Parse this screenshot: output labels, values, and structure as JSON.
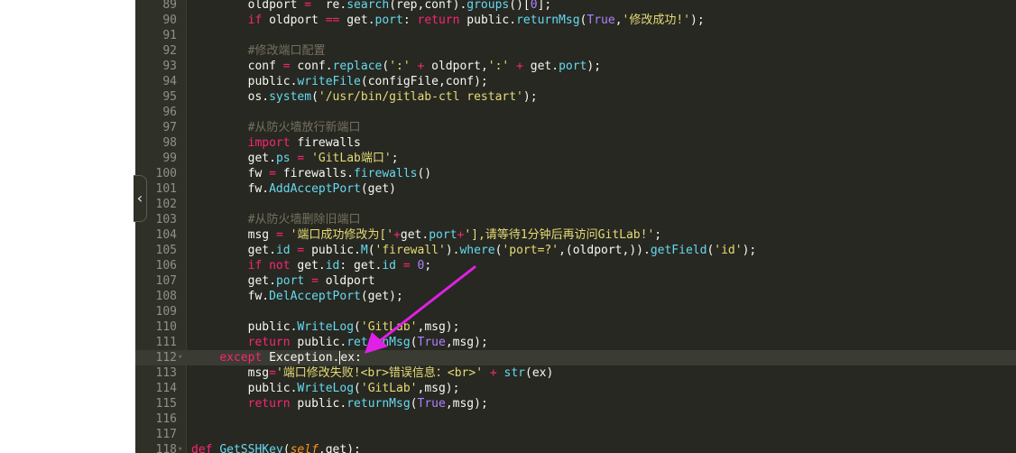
{
  "editor": {
    "lines": [
      {
        "num": "89",
        "tokens": [
          {
            "t": "oldport",
            "c": ""
          },
          {
            "t": " = ",
            "c": "o"
          },
          {
            "t": " re.",
            "c": ""
          },
          {
            "t": "search",
            "c": "f"
          },
          {
            "t": "(rep,conf).",
            "c": ""
          },
          {
            "t": "groups",
            "c": "f"
          },
          {
            "t": "()[",
            "c": ""
          },
          {
            "t": "0",
            "c": "n"
          },
          {
            "t": "];",
            "c": ""
          }
        ],
        "indent": "        "
      },
      {
        "num": "90",
        "tokens": [
          {
            "t": "if",
            "c": "k"
          },
          {
            "t": " oldport ",
            "c": ""
          },
          {
            "t": "==",
            "c": "o"
          },
          {
            "t": " get.",
            "c": ""
          },
          {
            "t": "port",
            "c": "f"
          },
          {
            "t": ": ",
            "c": ""
          },
          {
            "t": "return",
            "c": "k"
          },
          {
            "t": " public.",
            "c": ""
          },
          {
            "t": "returnMsg",
            "c": "f"
          },
          {
            "t": "(",
            "c": ""
          },
          {
            "t": "True",
            "c": "n"
          },
          {
            "t": ",",
            "c": ""
          },
          {
            "t": "'修改成功!'",
            "c": "s"
          },
          {
            "t": ");",
            "c": ""
          }
        ],
        "indent": "        "
      },
      {
        "num": "91",
        "tokens": [],
        "indent": ""
      },
      {
        "num": "92",
        "tokens": [
          {
            "t": "#修改端口配置",
            "c": "c"
          }
        ],
        "indent": "        "
      },
      {
        "num": "93",
        "tokens": [
          {
            "t": "conf ",
            "c": ""
          },
          {
            "t": "=",
            "c": "o"
          },
          {
            "t": " conf.",
            "c": ""
          },
          {
            "t": "replace",
            "c": "f"
          },
          {
            "t": "(",
            "c": ""
          },
          {
            "t": "':'",
            "c": "s"
          },
          {
            "t": " + ",
            "c": "o"
          },
          {
            "t": "oldport,",
            "c": ""
          },
          {
            "t": "':'",
            "c": "s"
          },
          {
            "t": " + ",
            "c": "o"
          },
          {
            "t": "get.",
            "c": ""
          },
          {
            "t": "port",
            "c": "f"
          },
          {
            "t": ");",
            "c": ""
          }
        ],
        "indent": "        "
      },
      {
        "num": "94",
        "tokens": [
          {
            "t": "public.",
            "c": ""
          },
          {
            "t": "writeFile",
            "c": "f"
          },
          {
            "t": "(configFile,conf);",
            "c": ""
          }
        ],
        "indent": "        "
      },
      {
        "num": "95",
        "tokens": [
          {
            "t": "os.",
            "c": ""
          },
          {
            "t": "system",
            "c": "f"
          },
          {
            "t": "(",
            "c": ""
          },
          {
            "t": "'/usr/bin/gitlab-ctl restart'",
            "c": "s"
          },
          {
            "t": ");",
            "c": ""
          }
        ],
        "indent": "        "
      },
      {
        "num": "96",
        "tokens": [],
        "indent": ""
      },
      {
        "num": "97",
        "tokens": [
          {
            "t": "#从防火墙放行新端口",
            "c": "c"
          }
        ],
        "indent": "        "
      },
      {
        "num": "98",
        "tokens": [
          {
            "t": "import",
            "c": "k"
          },
          {
            "t": " firewalls",
            "c": ""
          }
        ],
        "indent": "        "
      },
      {
        "num": "99",
        "tokens": [
          {
            "t": "get.",
            "c": ""
          },
          {
            "t": "ps",
            "c": "f"
          },
          {
            "t": " = ",
            "c": "o"
          },
          {
            "t": "'GitLab端口'",
            "c": "s"
          },
          {
            "t": ";",
            "c": ""
          }
        ],
        "indent": "        "
      },
      {
        "num": "100",
        "tokens": [
          {
            "t": "fw ",
            "c": ""
          },
          {
            "t": "=",
            "c": "o"
          },
          {
            "t": " firewalls.",
            "c": ""
          },
          {
            "t": "firewalls",
            "c": "f"
          },
          {
            "t": "()",
            "c": ""
          }
        ],
        "indent": "        "
      },
      {
        "num": "101",
        "tokens": [
          {
            "t": "fw.",
            "c": ""
          },
          {
            "t": "AddAcceptPort",
            "c": "f"
          },
          {
            "t": "(get)",
            "c": ""
          }
        ],
        "indent": "        "
      },
      {
        "num": "102",
        "tokens": [],
        "indent": ""
      },
      {
        "num": "103",
        "tokens": [
          {
            "t": "#从防火墙删除旧端口",
            "c": "c"
          }
        ],
        "indent": "        "
      },
      {
        "num": "104",
        "tokens": [
          {
            "t": "msg ",
            "c": ""
          },
          {
            "t": "=",
            "c": "o"
          },
          {
            "t": " ",
            "c": ""
          },
          {
            "t": "'端口成功修改为['",
            "c": "s"
          },
          {
            "t": "+",
            "c": "o"
          },
          {
            "t": "get.",
            "c": ""
          },
          {
            "t": "port",
            "c": "f"
          },
          {
            "t": "+",
            "c": "o"
          },
          {
            "t": "'],请等待1分钟后再访问GitLab!'",
            "c": "s"
          },
          {
            "t": ";",
            "c": ""
          }
        ],
        "indent": "        "
      },
      {
        "num": "105",
        "tokens": [
          {
            "t": "get.",
            "c": ""
          },
          {
            "t": "id",
            "c": "f"
          },
          {
            "t": " = ",
            "c": "o"
          },
          {
            "t": "public.",
            "c": ""
          },
          {
            "t": "M",
            "c": "f"
          },
          {
            "t": "(",
            "c": ""
          },
          {
            "t": "'firewall'",
            "c": "s"
          },
          {
            "t": ").",
            "c": ""
          },
          {
            "t": "where",
            "c": "f"
          },
          {
            "t": "(",
            "c": ""
          },
          {
            "t": "'port=?'",
            "c": "s"
          },
          {
            "t": ",(oldport,)).",
            "c": ""
          },
          {
            "t": "getField",
            "c": "f"
          },
          {
            "t": "(",
            "c": ""
          },
          {
            "t": "'id'",
            "c": "s"
          },
          {
            "t": ");",
            "c": ""
          }
        ],
        "indent": "        "
      },
      {
        "num": "106",
        "tokens": [
          {
            "t": "if",
            "c": "k"
          },
          {
            "t": " ",
            "c": ""
          },
          {
            "t": "not",
            "c": "k"
          },
          {
            "t": " get.",
            "c": ""
          },
          {
            "t": "id",
            "c": "f"
          },
          {
            "t": ": get.",
            "c": ""
          },
          {
            "t": "id",
            "c": "f"
          },
          {
            "t": " = ",
            "c": "o"
          },
          {
            "t": "0",
            "c": "n"
          },
          {
            "t": ";",
            "c": ""
          }
        ],
        "indent": "        "
      },
      {
        "num": "107",
        "tokens": [
          {
            "t": "get.",
            "c": ""
          },
          {
            "t": "port",
            "c": "f"
          },
          {
            "t": " = ",
            "c": "o"
          },
          {
            "t": "oldport",
            "c": ""
          }
        ],
        "indent": "        "
      },
      {
        "num": "108",
        "tokens": [
          {
            "t": "fw.",
            "c": ""
          },
          {
            "t": "DelAcceptPort",
            "c": "f"
          },
          {
            "t": "(get);",
            "c": ""
          }
        ],
        "indent": "        "
      },
      {
        "num": "109",
        "tokens": [],
        "indent": ""
      },
      {
        "num": "110",
        "tokens": [
          {
            "t": "public.",
            "c": ""
          },
          {
            "t": "WriteLog",
            "c": "f"
          },
          {
            "t": "(",
            "c": ""
          },
          {
            "t": "'GitLab'",
            "c": "s"
          },
          {
            "t": ",msg);",
            "c": ""
          }
        ],
        "indent": "        "
      },
      {
        "num": "111",
        "tokens": [
          {
            "t": "return",
            "c": "k"
          },
          {
            "t": " public.",
            "c": ""
          },
          {
            "t": "returnMsg",
            "c": "f"
          },
          {
            "t": "(",
            "c": ""
          },
          {
            "t": "True",
            "c": "n"
          },
          {
            "t": ",msg);",
            "c": ""
          }
        ],
        "indent": "        "
      },
      {
        "num": "112",
        "tokens": [
          {
            "t": "except",
            "c": "k"
          },
          {
            "t": " Exception.",
            "c": ""
          },
          {
            "t": "|",
            "c": "cursor"
          },
          {
            "t": "ex:",
            "c": ""
          }
        ],
        "indent": "    ",
        "active": true,
        "fold": "▾"
      },
      {
        "num": "113",
        "tokens": [
          {
            "t": "msg",
            "c": ""
          },
          {
            "t": "=",
            "c": "o"
          },
          {
            "t": "'端口修改失败!<br>错误信息：<br>'",
            "c": "s"
          },
          {
            "t": " + ",
            "c": "o"
          },
          {
            "t": "str",
            "c": "f"
          },
          {
            "t": "(ex)",
            "c": ""
          }
        ],
        "indent": "        "
      },
      {
        "num": "114",
        "tokens": [
          {
            "t": "public.",
            "c": ""
          },
          {
            "t": "WriteLog",
            "c": "f"
          },
          {
            "t": "(",
            "c": ""
          },
          {
            "t": "'GitLab'",
            "c": "s"
          },
          {
            "t": ",msg);",
            "c": ""
          }
        ],
        "indent": "        "
      },
      {
        "num": "115",
        "tokens": [
          {
            "t": "return",
            "c": "k"
          },
          {
            "t": " public.",
            "c": ""
          },
          {
            "t": "returnMsg",
            "c": "f"
          },
          {
            "t": "(",
            "c": ""
          },
          {
            "t": "True",
            "c": "n"
          },
          {
            "t": ",msg);",
            "c": ""
          }
        ],
        "indent": "        "
      },
      {
        "num": "116",
        "tokens": [],
        "indent": ""
      },
      {
        "num": "117",
        "tokens": [],
        "indent": ""
      },
      {
        "num": "118",
        "tokens": [
          {
            "t": "def",
            "c": "k"
          },
          {
            "t": " ",
            "c": ""
          },
          {
            "t": "GetSSHKey",
            "c": "f"
          },
          {
            "t": "(",
            "c": ""
          },
          {
            "t": "self",
            "c": "p"
          },
          {
            "t": ",get):",
            "c": ""
          }
        ],
        "indent": "",
        "fold": "▾"
      }
    ]
  },
  "collapse_tab": {
    "glyph": "‹"
  },
  "annotation": {
    "color": "#e020e6"
  },
  "colors": {
    "background": "#272822",
    "gutter": "#2f3129",
    "keyword": "#f92672",
    "function": "#66d9ef",
    "string": "#e6db74",
    "number": "#ae81ff",
    "comment": "#75715e"
  }
}
